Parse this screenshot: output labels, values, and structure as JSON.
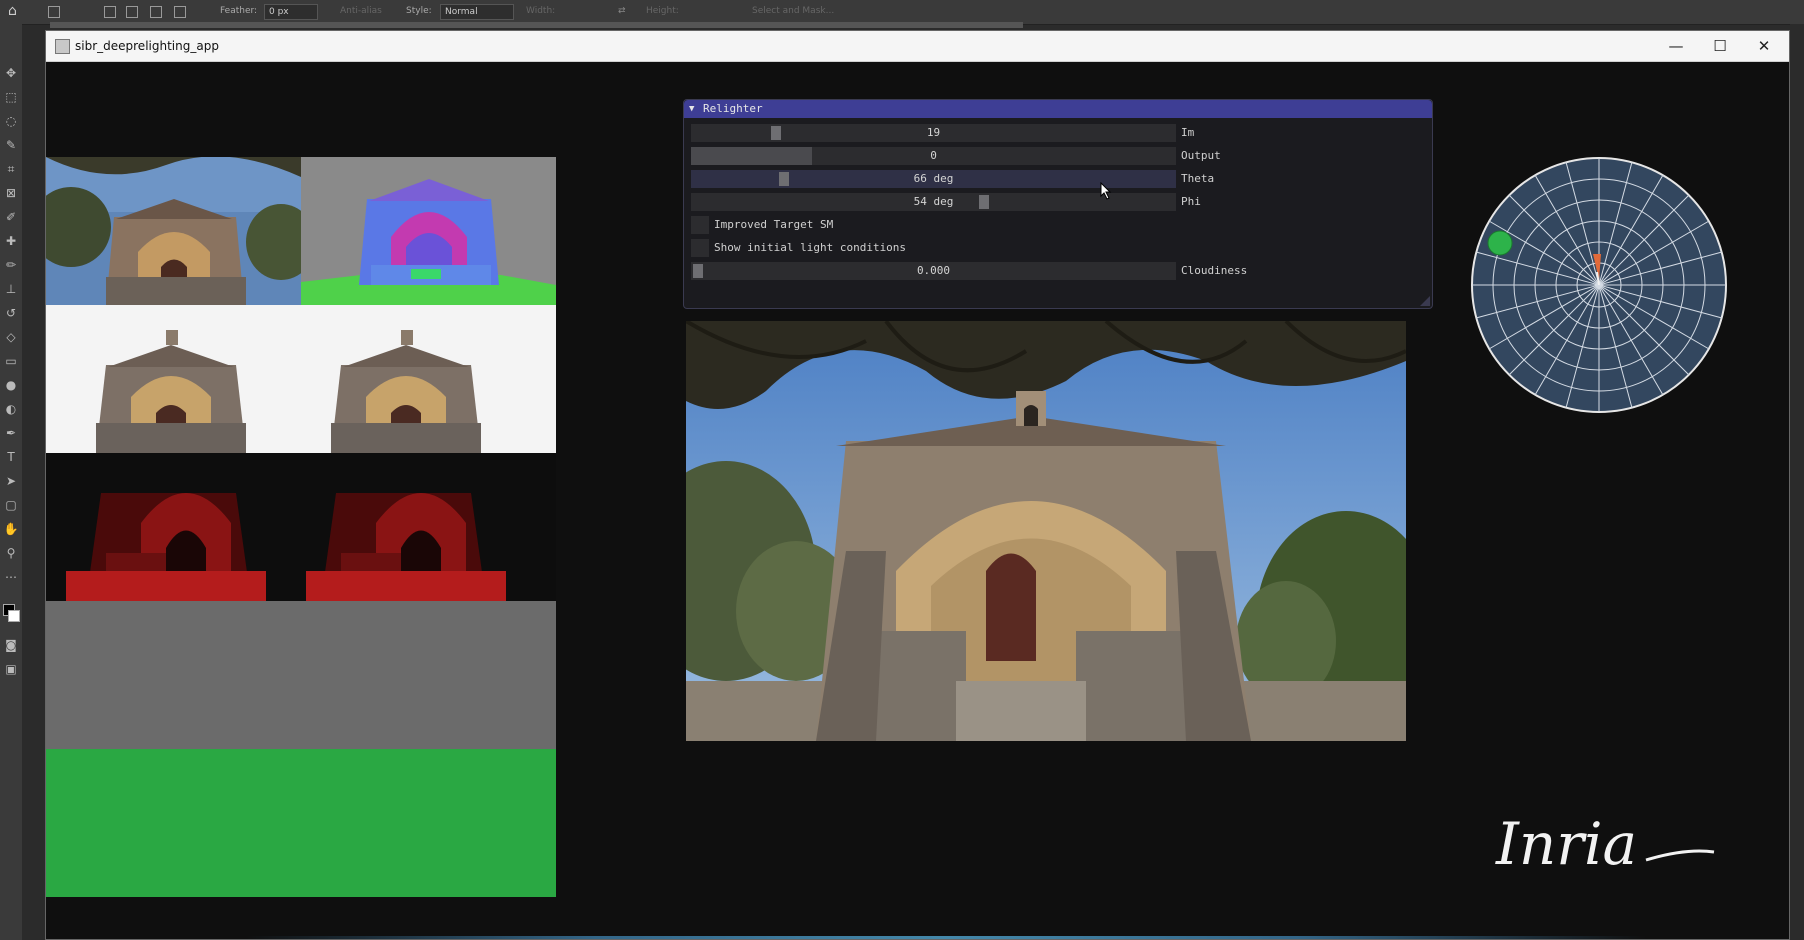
{
  "host": {
    "feather_label": "Feather:",
    "feather_value": "0 px",
    "antialias_label": "Anti-alias",
    "style_label": "Style:",
    "style_value": "Normal",
    "width_label": "Width:",
    "height_label": "Height:",
    "select_mask_label": "Select and Mask..."
  },
  "window": {
    "title": "sibr_deeprelighting_app",
    "icon": "app-window-icon",
    "controls": [
      "minimize-icon",
      "maximize-icon",
      "close-icon"
    ]
  },
  "relighter": {
    "title": "Relighter",
    "sliders": [
      {
        "label": "Im",
        "value": "19",
        "fraction": 0.18
      },
      {
        "label": "Output",
        "value": "0",
        "fraction": 0.25
      },
      {
        "label": "Theta",
        "value": "66 deg",
        "fraction": 0.19
      },
      {
        "label": "Phi",
        "value": "54 deg",
        "fraction": 0.6
      }
    ],
    "checkboxes": [
      {
        "label": "Improved Target SM",
        "checked": false
      },
      {
        "label": "Show initial light conditions",
        "checked": false
      }
    ],
    "cloudiness": {
      "label": "Cloudiness",
      "value": "0.000",
      "fraction": 0.0
    }
  },
  "light_direction": {
    "theta_deg": 66,
    "phi_deg": 54,
    "sun_color": "#2db34a",
    "indicator_color": "#e06a3a",
    "disc_color": "#33475f"
  },
  "thumbnails": [
    {
      "name": "input-photo",
      "kind": "photo"
    },
    {
      "name": "normal-map",
      "kind": "normals"
    },
    {
      "name": "albedo-a",
      "kind": "photo-white"
    },
    {
      "name": "albedo-b",
      "kind": "photo-white"
    },
    {
      "name": "shadow-a",
      "kind": "red"
    },
    {
      "name": "shadow-b",
      "kind": "red"
    },
    {
      "name": "gray-buffer",
      "kind": "flat",
      "color": "#6b6b6b"
    },
    {
      "name": "green-buffer",
      "kind": "flat",
      "color": "#2aa843"
    }
  ],
  "logo_text": "Inria"
}
